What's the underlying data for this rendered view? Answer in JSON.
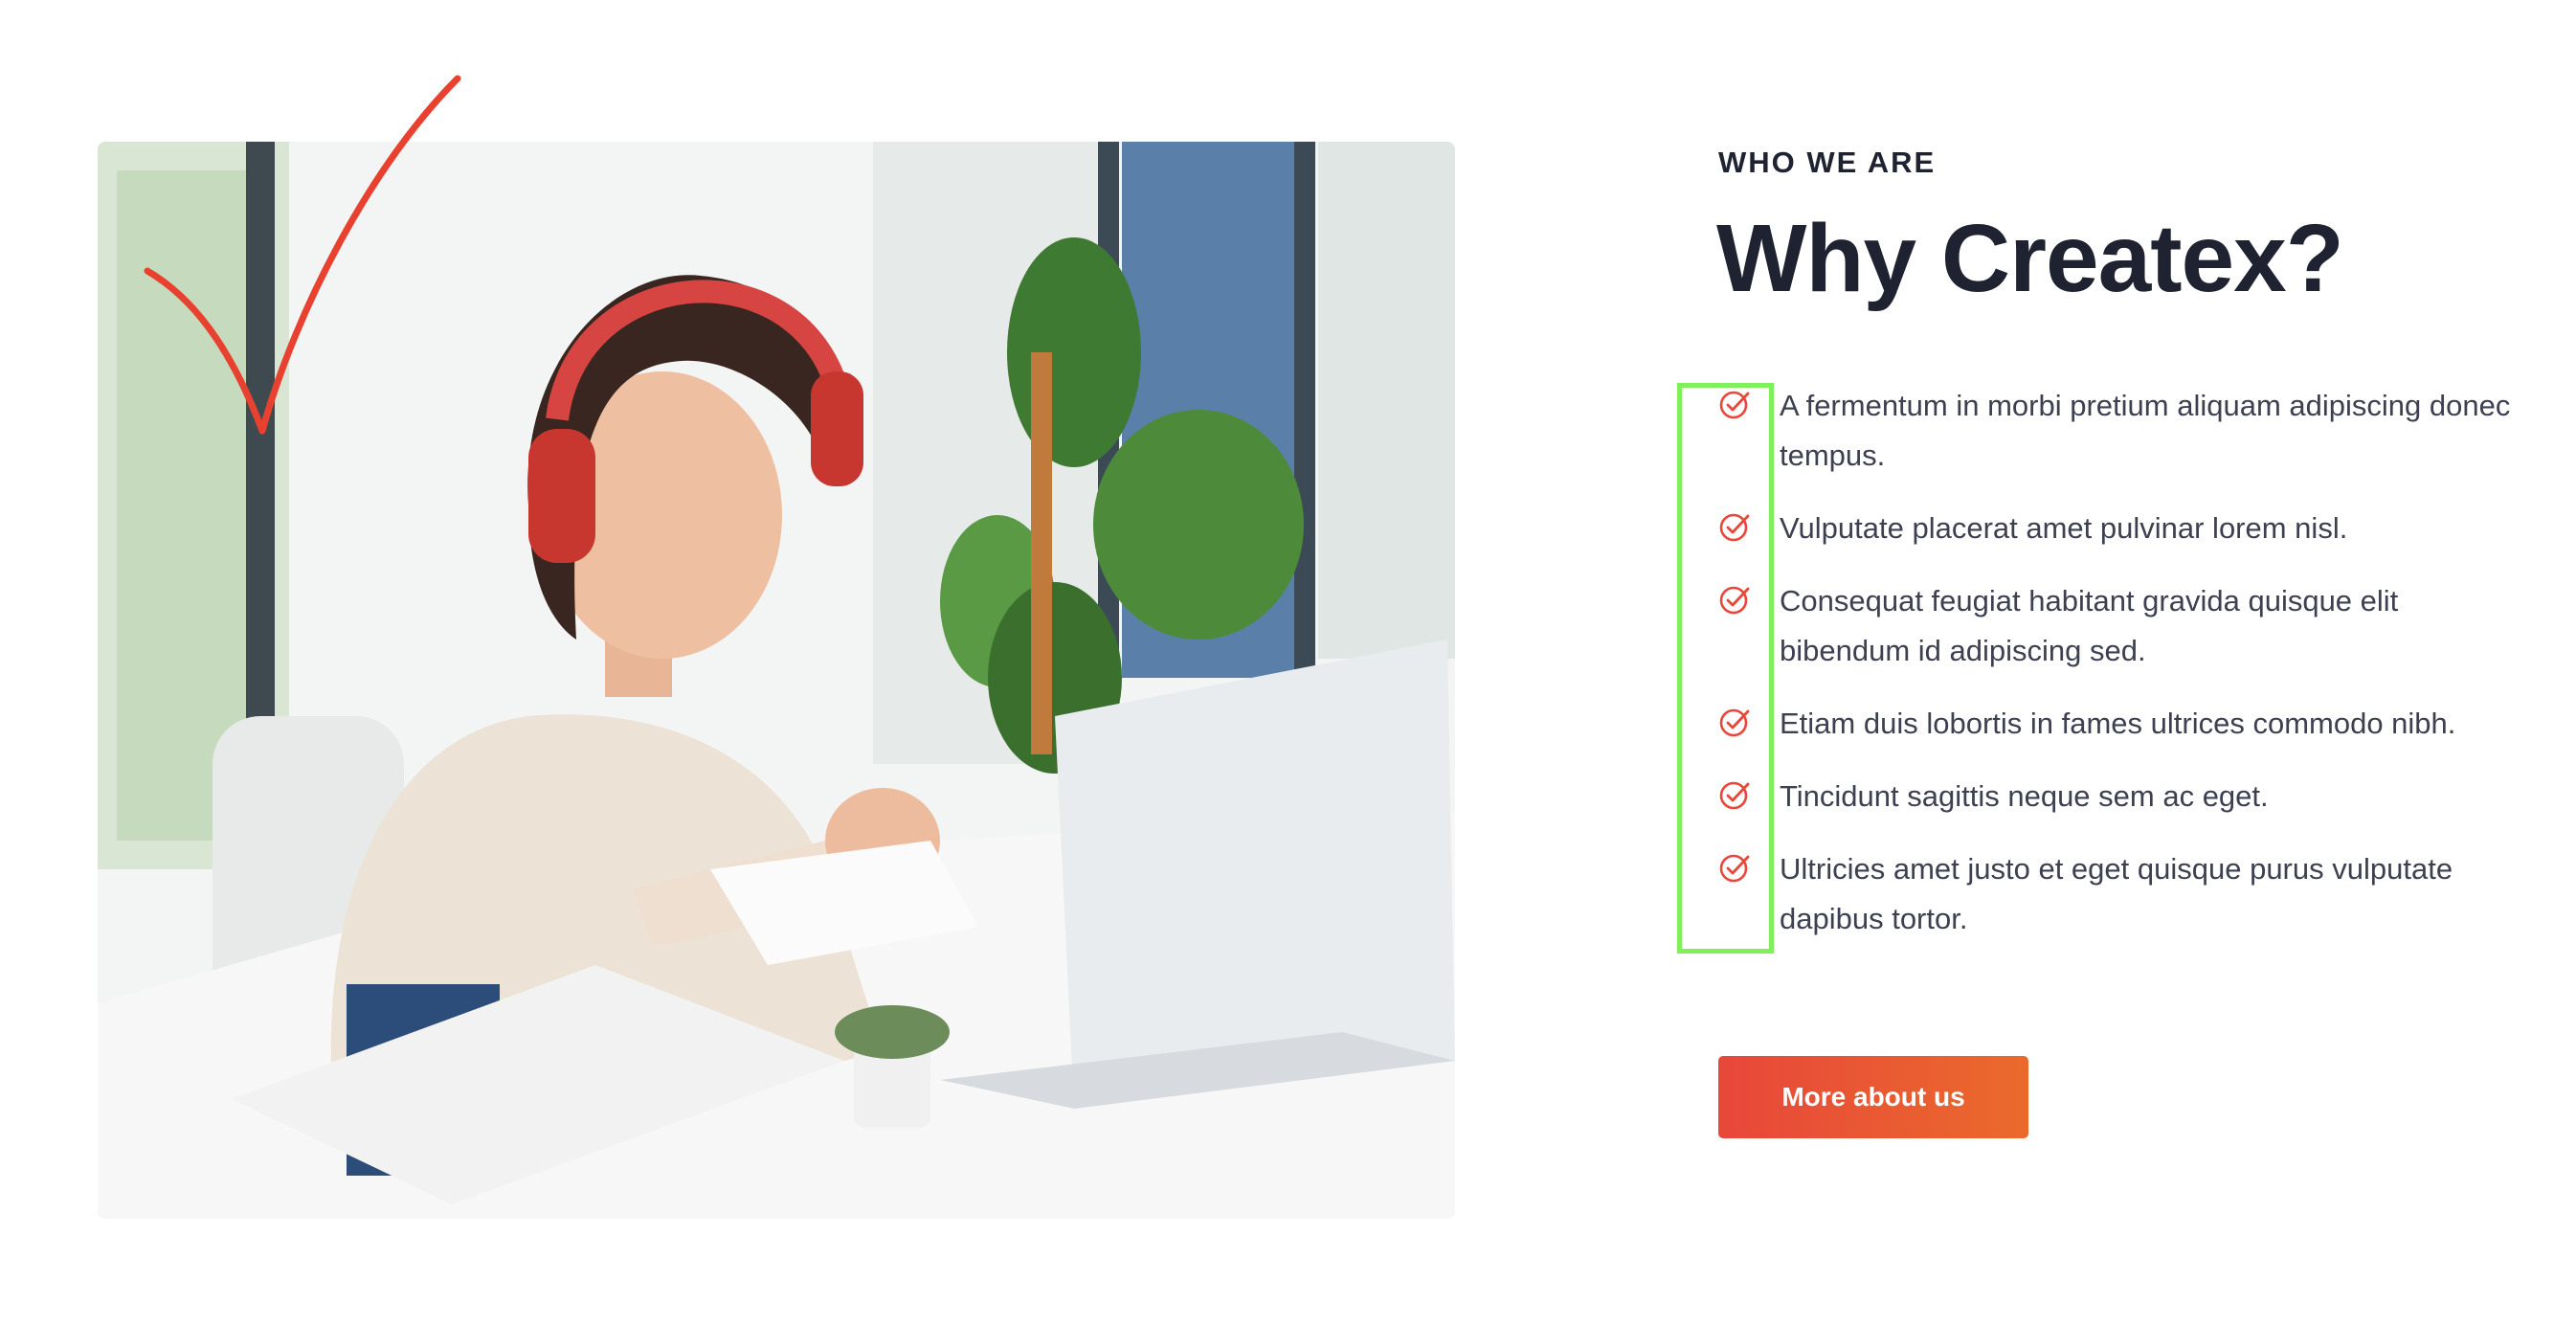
{
  "section": {
    "eyebrow": "WHO WE ARE",
    "title": "Why Createx?",
    "features": [
      "A fermentum in morbi pretium aliquam adipiscing donec tempus.",
      "Vulputate placerat amet pulvinar lorem nisl.",
      "Consequat feugiat habitant gravida quisque elit bibendum id adipiscing sed.",
      "Etiam duis lobortis in fames ultrices commodo nibh.",
      "Tincidunt sagittis neque sem ac eget.",
      "Ultricies amet justo et eget quisque purus vulputate dapibus tortor."
    ],
    "cta_label": "More about us"
  },
  "icons": {
    "feature": "check-circle-icon",
    "decoration": "hand-drawn-checkmark"
  },
  "colors": {
    "accent": "#e8473a",
    "accent_end": "#ea6a2c",
    "heading": "#1f2230",
    "body_text": "#3d4050",
    "highlight": "#7ff05a"
  }
}
